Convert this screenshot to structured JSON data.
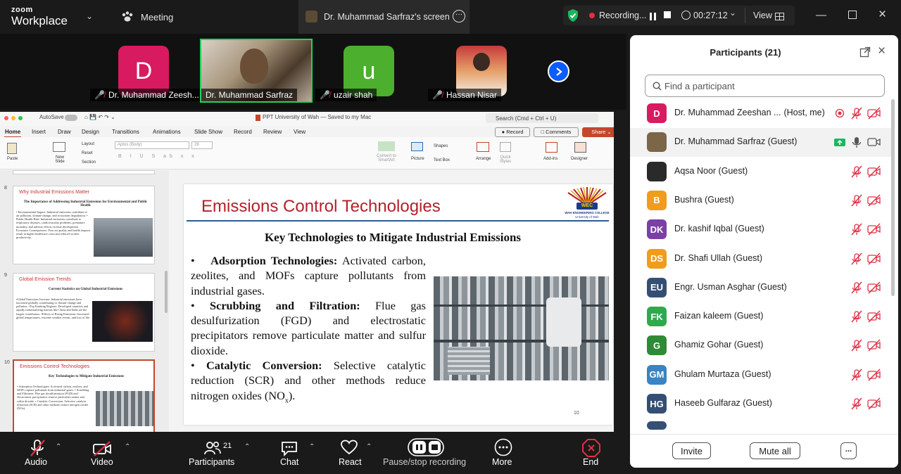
{
  "topbar": {
    "brand_top": "zoom",
    "brand_bottom": "Workplace",
    "meeting": "Meeting",
    "screen_tab": "Dr. Muhammad Sarfraz's screen",
    "recording": "Recording...",
    "timer": "00:27:12",
    "view": "View"
  },
  "strip": {
    "tiles": [
      {
        "name": "Dr. Muhammad Zeesh...",
        "initial": "D",
        "color": "#d81b60"
      },
      {
        "name": "Dr. Muhammad Sarfraz",
        "initial": "",
        "color": "#9a8060"
      },
      {
        "name": "uzair shah",
        "initial": "u",
        "color": "#4caf2e"
      },
      {
        "name": "Hassan Nisar",
        "initial": "",
        "color": "#a12a2a"
      }
    ]
  },
  "ppt": {
    "autosave": "AutoSave",
    "title": "PPT University of Wah — Saved to my Mac",
    "search": "Search (Cmd + Ctrl + U)",
    "tabs": [
      "Home",
      "Insert",
      "Draw",
      "Design",
      "Transitions",
      "Animations",
      "Slide Show",
      "Record",
      "Review",
      "View"
    ],
    "record_btn": "Record",
    "comments_btn": "Comments",
    "share_btn": "Share",
    "ribbon": {
      "paste": "Paste",
      "new_slide": "New Slide",
      "layout": "Layout",
      "reset": "Reset",
      "section": "Section",
      "font": "Aptos (Body)",
      "size": "28",
      "convert": "Convert to SmartArt",
      "picture": "Picture",
      "shapes": "Shapes",
      "textbox": "Text Box",
      "arrange": "Arrange",
      "quick": "Quick Styles",
      "addins": "Add-ins",
      "designer": "Designer"
    },
    "thumbs": [
      {
        "num": "8",
        "title": "Why Industrial Emissions Matter",
        "head": "The Importance of Addressing Industrial Emissions for Environmental and Public Health",
        "body": "• Environmental Impact: Industrial emissions contribute to air pollution, climate change, and ecosystem degradation. • Public Health Risk: Industrial emissions contribute to respiratory diseases, cardiovascular problems, premature mortality, and adverse effects on fetal development. Economic Consequences: Poor air quality and health impacts result in higher healthcare costs and reduced worker productivity."
      },
      {
        "num": "9",
        "title": "Global Emission Trends",
        "head": "Current Statistics on Global Industrial Emissions",
        "body": "•Global Emissions Increase: Industrial emissions have increased globally contributing to climate change and pollution. •Top Emitting Regions: Developed countries and rapidly industrializing nations like China and India are the largest contributors. •Effects of Rising Emissions: Increased global temperatures, extreme weather events, and loss of life."
      },
      {
        "num": "10",
        "title": "Emissions Control Technologies",
        "head": "Key Technologies to Mitigate Industrial Emissions",
        "body": "• Adsorption Technologies: Activated carbon, zeolites, and MOFs capture pollutants from industrial gases. • Scrubbing and Filtration: Flue gas desulfurization (FGD) and electrostatic precipitators remove particulate matter and sulfur dioxide. • Catalytic Conversion: Selective catalytic reduction (SCR) and other methods reduce nitrogen oxides (NOx)."
      }
    ],
    "slide": {
      "title": "Emissions Control Technologies",
      "logo": "WEC",
      "logo_sub": "WAH ENGINEERING COLLEGE",
      "logo_sub2": "University of Wah",
      "heading": "Key Technologies to Mitigate Industrial Emissions",
      "b1_head": "Adsorption Technologies:",
      "b1_text": " Activated carbon, zeolites, and MOFs capture pollutants from industrial gases.",
      "b2_head": "Scrubbing and Filtration:",
      "b2_text": " Flue gas desulfurization (FGD) and electrostatic precipitators remove particulate matter and sulfur dioxide.",
      "b3_head": "Catalytic Conversion:",
      "b3_text": " Selective catalytic reduction (SCR) and other methods reduce nitrogen oxides (NO",
      "b3_sub": "x",
      "b3_end": ").",
      "num": "10"
    }
  },
  "panel": {
    "title": "Participants (21)",
    "search_placeholder": "Find a participant",
    "participants": [
      {
        "initials": "D",
        "name": "Dr. Muhammad Zeeshan ...",
        "role": "(Host, me)",
        "color": "#d81b60",
        "photo": false
      },
      {
        "initials": "",
        "name": "Dr. Muhammad Sarfraz (Guest)",
        "role": "",
        "color": "#7b6648",
        "photo": true
      },
      {
        "initials": "",
        "name": "Aqsa Noor (Guest)",
        "role": "",
        "color": "#2a2a2a",
        "photo": true
      },
      {
        "initials": "B",
        "name": "Bushra (Guest)",
        "role": "",
        "color": "#f09c1c",
        "photo": false
      },
      {
        "initials": "DK",
        "name": "Dr. kashif Iqbal (Guest)",
        "role": "",
        "color": "#7b3fa6",
        "photo": false
      },
      {
        "initials": "DS",
        "name": "Dr. Shafi Ullah (Guest)",
        "role": "",
        "color": "#f09c1c",
        "photo": false
      },
      {
        "initials": "EU",
        "name": "Engr. Usman Asghar (Guest)",
        "role": "",
        "color": "#344f73",
        "photo": false
      },
      {
        "initials": "FK",
        "name": "Faizan kaleem (Guest)",
        "role": "",
        "color": "#2eaa4e",
        "photo": false
      },
      {
        "initials": "G",
        "name": "Ghamiz Gohar (Guest)",
        "role": "",
        "color": "#2e8a35",
        "photo": false
      },
      {
        "initials": "GM",
        "name": "Ghulam Murtaza (Guest)",
        "role": "",
        "color": "#3884c4",
        "photo": false
      },
      {
        "initials": "HG",
        "name": "Haseeb Gulfaraz (Guest)",
        "role": "",
        "color": "#344f73",
        "photo": false
      }
    ],
    "invite": "Invite",
    "mute_all": "Mute all",
    "more": "..."
  },
  "toolbar": {
    "audio": "Audio",
    "video": "Video",
    "participants": "Participants",
    "participants_count": "21",
    "chat": "Chat",
    "react": "React",
    "recording": "Pause/stop recording",
    "more": "More",
    "end": "End"
  },
  "colors": {
    "accent": "#0b5cff",
    "danger": "#e02f44",
    "brand_red": "#b3202c"
  }
}
